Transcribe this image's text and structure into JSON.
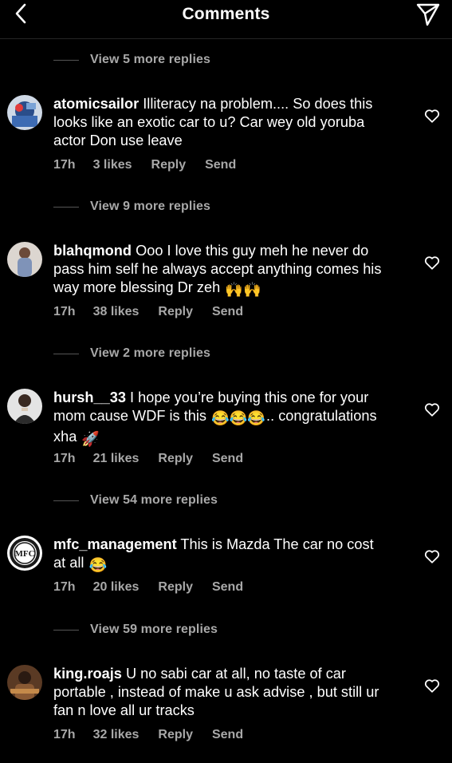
{
  "header": {
    "title": "Comments"
  },
  "feed": {
    "threads": [
      {
        "view_replies": "View 5 more replies"
      },
      {
        "view_replies": "View 9 more replies"
      },
      {
        "view_replies": "View 2 more replies"
      },
      {
        "view_replies": "View 54 more replies"
      },
      {
        "view_replies": "View 59 more replies"
      }
    ],
    "comments": [
      {
        "username": "atomicsailor",
        "text": "Illiteracy na problem.... So does this looks like an exotic car to u? Car wey old yoruba actor Don use leave",
        "time": "17h",
        "likes": "3 likes",
        "reply": "Reply",
        "send": "Send"
      },
      {
        "username": "blahqmond",
        "text": "Ooo I love this guy meh he never do pass him self he always accept anything comes his way more blessing Dr zeh",
        "emoji": "🙌🙌",
        "time": "17h",
        "likes": "38 likes",
        "reply": "Reply",
        "send": "Send"
      },
      {
        "username": "hursh__33",
        "text": "I hope you’re buying this one for your mom cause WDF is this",
        "emoji": "😂😂😂",
        "text_after": "..",
        "text_line3": "congratulations xha",
        "emoji2": "🚀",
        "time": "17h",
        "likes": "21 likes",
        "reply": "Reply",
        "send": "Send"
      },
      {
        "username": "mfc_management",
        "text": "This is Mazda  The car no cost at all",
        "emoji": "😂",
        "time": "17h",
        "likes": "20 likes",
        "reply": "Reply",
        "send": "Send"
      },
      {
        "username": "king.roajs",
        "text": "U no sabi car at all, no taste of car portable , instead of make u ask advise , but still ur fan n love all ur tracks",
        "time": "17h",
        "likes": "32 likes",
        "reply": "Reply",
        "send": "Send"
      }
    ]
  },
  "icons": {
    "back": "chevron-left-icon",
    "share": "paper-plane-icon",
    "like": "heart-outline-icon"
  },
  "colors": {
    "background": "#000000",
    "primary_text": "#ffffff",
    "secondary_text": "#a8a8a8",
    "divider": "#262626"
  }
}
